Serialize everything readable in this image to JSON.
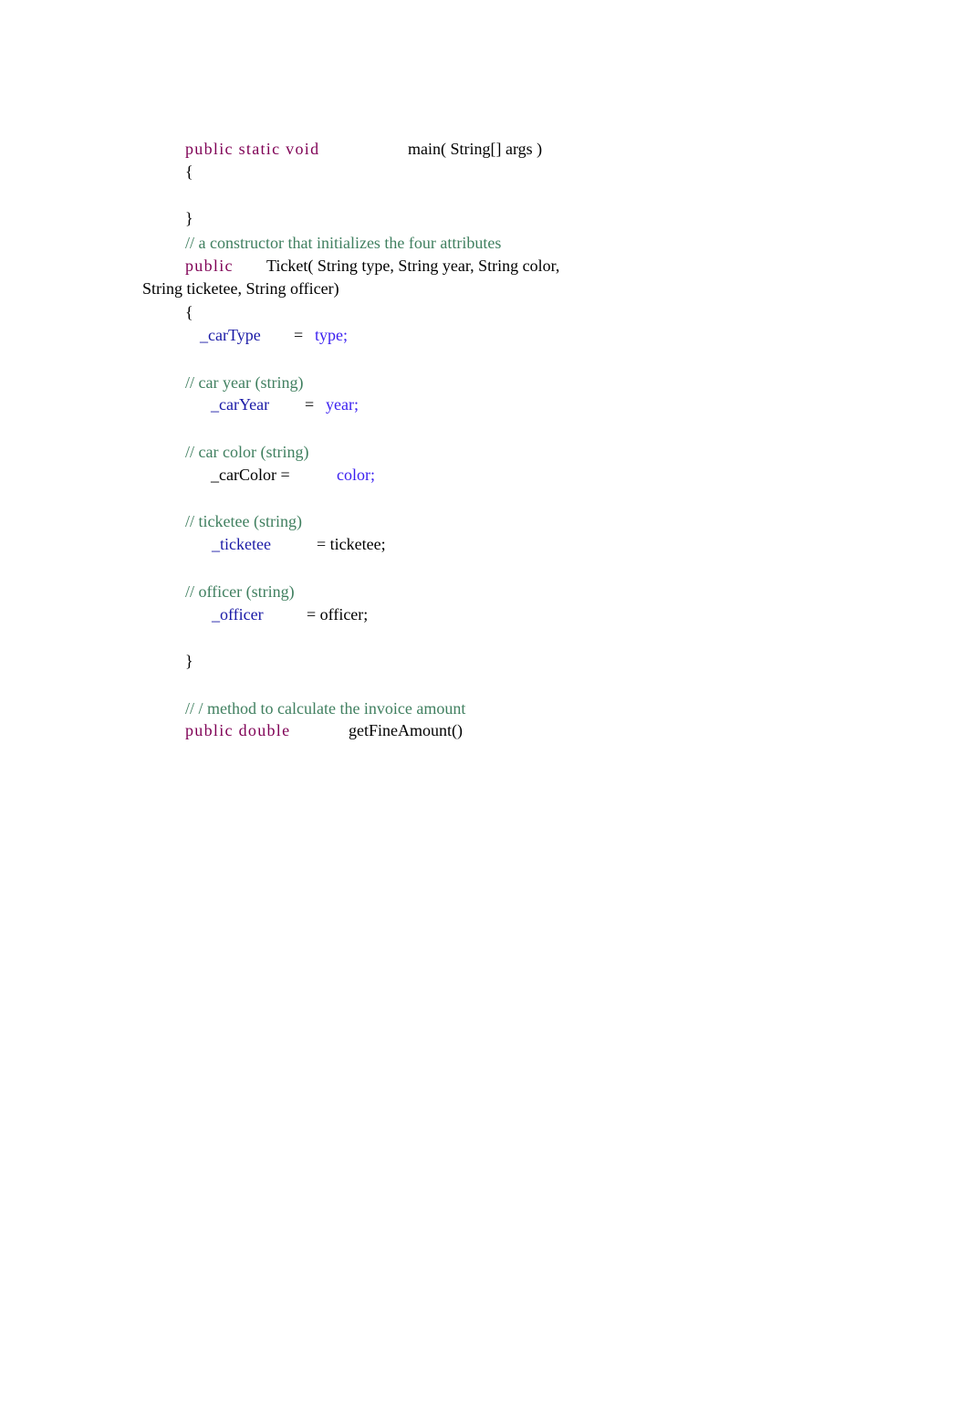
{
  "document": {
    "main_method": {
      "keywords": "public static void",
      "signature": "main( String[] args )",
      "open_brace": "{",
      "close_brace": "}"
    },
    "constructor": {
      "comment": "// a constructor that initializes the four attributes",
      "keyword": "public",
      "signature_line1": "Ticket( String type, String year, String color,",
      "signature_line2": "String ticketee, String officer)",
      "open_brace": "{",
      "close_brace": "}",
      "assignments": [
        {
          "comment": "",
          "field": "_carType",
          "op": "=",
          "value": "type;"
        },
        {
          "comment": "// car year (string)",
          "field": "_carYear",
          "op": "=",
          "value": "year;"
        },
        {
          "comment": "// car color (string)",
          "field": "_carColor =",
          "op": "",
          "value": "color;"
        },
        {
          "comment": "// ticketee (string)",
          "field": "_ticketee",
          "op": "= ticketee;",
          "value": ""
        },
        {
          "comment": "// officer (string)",
          "field": "_officer",
          "op": "= officer;",
          "value": ""
        }
      ]
    },
    "fine_method": {
      "comment": "// / method to calculate the invoice amount",
      "keywords": "public double",
      "signature": "getFineAmount()"
    }
  },
  "colors": {
    "keyword": "#7f0055",
    "comment": "#3f7f5f",
    "field": "#1a1aa6",
    "value": "#3a1ff0",
    "text": "#000000"
  }
}
